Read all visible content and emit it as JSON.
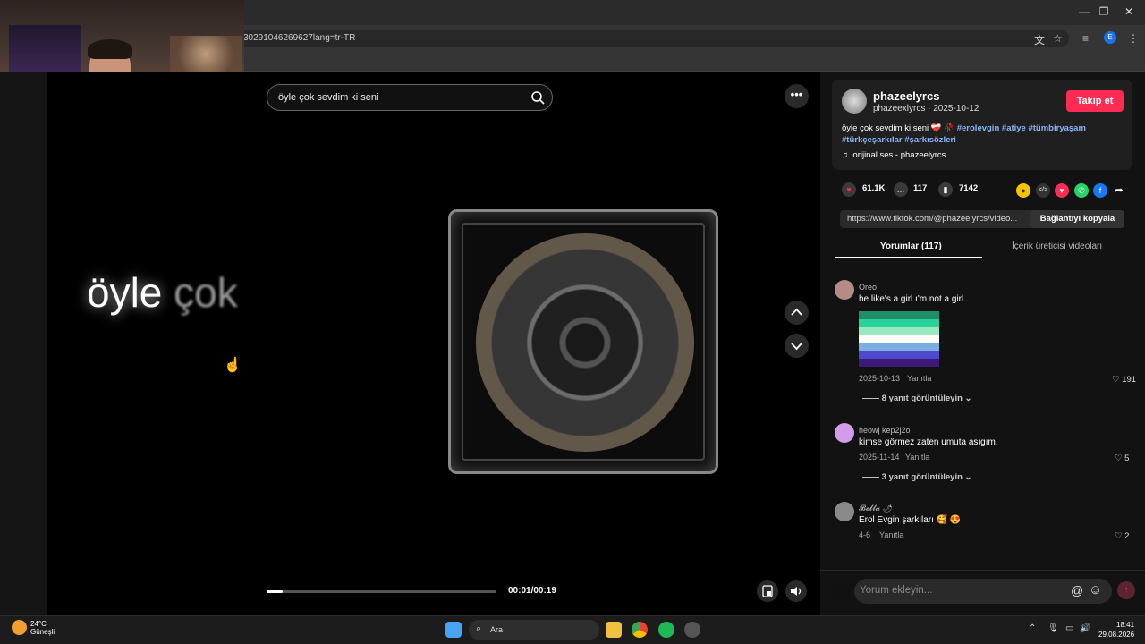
{
  "browser": {
    "url": "30291046269627lang=tr-TR",
    "profile_letter": "E"
  },
  "video": {
    "search_value": "öyle çok sevdim ki seni",
    "lyric_bright": "öyle",
    "lyric_dim": "çok",
    "time": "00:01/00:19",
    "progress": 0.07
  },
  "post": {
    "username": "phazeelyrcs",
    "meta": "phazeexlyrcs · 2025-10-12",
    "follow_label": "Takip et",
    "desc_text": "öyle çok sevdim ki seni ❤️‍🩹 🥀",
    "tags": [
      "#erolevgin",
      "#atiye",
      "#tümbiryaşam",
      "#türkçeşarkılar",
      "#şarkısözleri"
    ],
    "music": "orijinal ses - phazeelyrcs",
    "likes": "61.1K",
    "comments": "117",
    "saves": "7142",
    "link": "https://www.tiktok.com/@phazeelyrcs/video...",
    "copy_label": "Bağlantıyı kopyala"
  },
  "tabs": {
    "comments": "Yorumlar (117)",
    "creator_videos": "İçerik üreticisi videoları"
  },
  "comments": [
    {
      "name": "Oreo",
      "text": "he like's a girl ı'm not a girl..",
      "date": "2025-10-13",
      "reply": "Yanıtla",
      "likes": "191",
      "replies": "8 yanıt görüntüleyin"
    },
    {
      "name": "heowj kep2j2o",
      "text": "kimse görmez zaten umuta asıgım.",
      "date": "2025-11-14",
      "reply": "Yanıtla",
      "likes": "5",
      "replies": "3 yanıt görüntüleyin"
    },
    {
      "name": "𝓑𝓮𝓵𝓵𝓪 🌶",
      "text": "Erol Evgin şarkıları 🥰 😍",
      "date": "4-6",
      "reply": "Yanıtla",
      "likes": "2"
    }
  ],
  "comment_input": {
    "placeholder": "Yorum ekleyin..."
  },
  "taskbar": {
    "temp": "24°C",
    "weather": "Güneşli",
    "search": "Ara",
    "time": "18:41",
    "date": "29.08.2026"
  },
  "colors": {
    "accent": "#fe2c55",
    "link": "#8ab4f8"
  }
}
